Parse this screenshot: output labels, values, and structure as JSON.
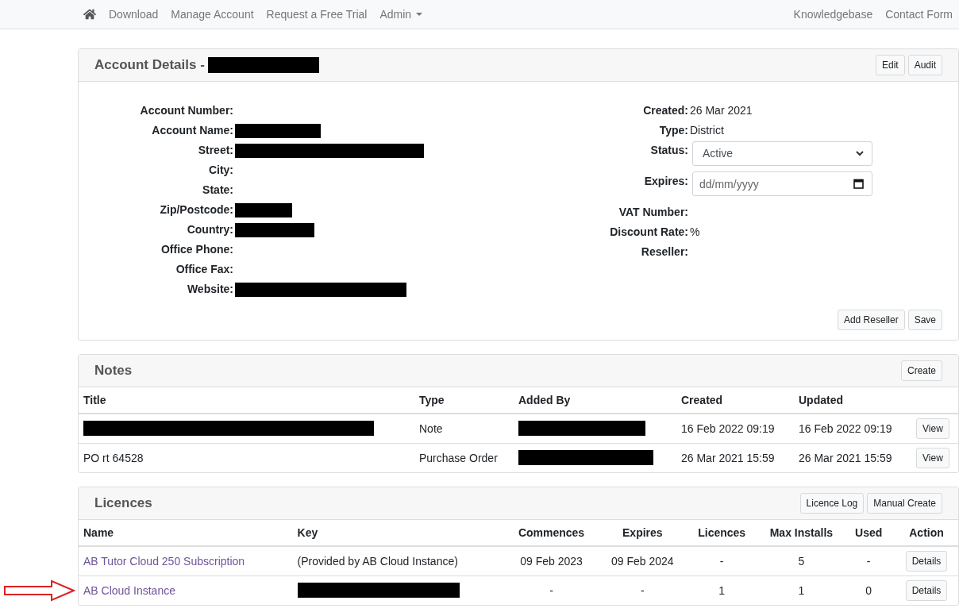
{
  "nav": {
    "items": [
      {
        "kind": "home"
      },
      {
        "kind": "link",
        "label": "Download"
      },
      {
        "kind": "link",
        "label": "Manage Account"
      },
      {
        "kind": "link",
        "label": "Request a Free Trial"
      },
      {
        "kind": "dropdown",
        "label": "Admin"
      }
    ],
    "right_items": [
      "Knowledgebase",
      "Contact Form"
    ]
  },
  "account": {
    "title": "Account Details -",
    "title_redacted": true,
    "buttons": [
      "Edit",
      "Audit"
    ],
    "left_fields": [
      {
        "label": "Account Number:",
        "redacted": false
      },
      {
        "label": "Account Name:",
        "redacted": true
      },
      {
        "label": "Street:",
        "redacted": true
      },
      {
        "label": "City:",
        "redacted": false
      },
      {
        "label": "State:",
        "redacted": false
      },
      {
        "label": "Zip/Postcode:",
        "redacted": true
      },
      {
        "label": "Country:",
        "redacted": true
      },
      {
        "label": "Office Phone:",
        "redacted": false
      },
      {
        "label": "Office Fax:",
        "redacted": false
      },
      {
        "label": "Website:",
        "redacted": true
      }
    ],
    "right_fields": [
      {
        "kind": "text",
        "label": "Created:",
        "value": "26 Mar 2021"
      },
      {
        "kind": "text",
        "label": "Type:",
        "value": "District"
      },
      {
        "kind": "select",
        "label": "Status:",
        "value": "Active"
      },
      {
        "kind": "date",
        "label": "Expires:",
        "placeholder": "dd/mm/yyyy"
      },
      {
        "kind": "text",
        "label": "VAT Number:"
      },
      {
        "kind": "text",
        "label": "Discount Rate:",
        "value": "%"
      },
      {
        "kind": "text",
        "label": "Reseller:"
      }
    ],
    "footer_buttons": [
      "Add Reseller",
      "Save"
    ]
  },
  "notes": {
    "title": "Notes",
    "buttons": [
      "Create"
    ],
    "columns": [
      "Title",
      "Type",
      "Added By",
      "Created",
      "Updated"
    ],
    "rows": [
      {
        "cells": [
          {
            "kind": "redacted"
          },
          {
            "kind": "text",
            "text": "Note"
          },
          {
            "kind": "redacted"
          },
          {
            "kind": "text",
            "text": "16 Feb 2022 09:19"
          },
          {
            "kind": "text",
            "text": "16 Feb 2022 09:19"
          }
        ],
        "action": "View"
      },
      {
        "cells": [
          {
            "kind": "text",
            "text": "PO rt 64528"
          },
          {
            "kind": "text",
            "text": "Purchase Order"
          },
          {
            "kind": "redacted"
          },
          {
            "kind": "text",
            "text": "26 Mar 2021 15:59"
          },
          {
            "kind": "text",
            "text": "26 Mar 2021 15:59"
          }
        ],
        "action": "View"
      }
    ]
  },
  "licences": {
    "title": "Licences",
    "buttons": [
      "Licence Log",
      "Manual Create"
    ],
    "columns": [
      "Name",
      "Key",
      "Commences",
      "Expires",
      "Licences",
      "Max Installs",
      "Used",
      "Action"
    ],
    "rows": [
      {
        "marked": false,
        "name": "AB Tutor Cloud 250 Subscription",
        "key": {
          "kind": "text",
          "text": "(Provided by AB Cloud Instance)"
        },
        "commences": "09 Feb 2023",
        "expires": "09 Feb 2024",
        "licences": "-",
        "max_installs": "5",
        "used": "-",
        "action": "Details"
      },
      {
        "marked": true,
        "name": "AB Cloud Instance",
        "key": {
          "kind": "redacted"
        },
        "commences": "-",
        "expires": "-",
        "licences": "1",
        "max_installs": "1",
        "used": "0",
        "action": "Details"
      }
    ]
  }
}
